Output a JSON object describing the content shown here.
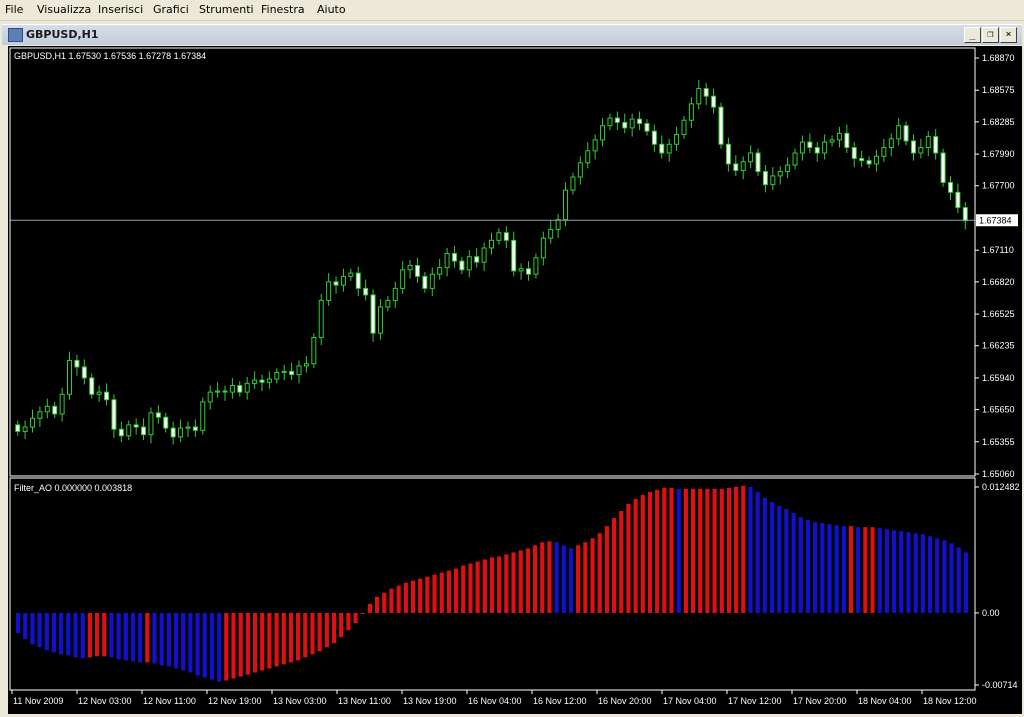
{
  "menu": {
    "items": [
      "File",
      "Visualizza",
      "Inserisci",
      "Grafici",
      "Strumenti",
      "Finestra",
      "Aiuto"
    ]
  },
  "window": {
    "title": "GBPUSD,H1",
    "buttons": {
      "minimize": "_",
      "restore": "❐",
      "close": "×"
    }
  },
  "main_chart": {
    "legend": "GBPUSD,H1  1.67530 1.67536 1.67278 1.67384",
    "current_price_label": "1.67384",
    "current_price_color": "#ffffff",
    "candle_color": "#33cc33",
    "bull_fill": "#000000",
    "bear_fill": "#ffffff"
  },
  "indicator": {
    "legend": "Filter_AO 0.000000 0.003818",
    "up_color": "#dd1111",
    "down_color": "#1111cc"
  },
  "chart_data": [
    {
      "type": "candlestick",
      "title": "GBPUSD,H1",
      "ylim": [
        1.6506,
        1.6887
      ],
      "y_ticks": [
        "1.68870",
        "1.68575",
        "1.68285",
        "1.67990",
        "1.67700",
        "1.67110",
        "1.66820",
        "1.66525",
        "1.66235",
        "1.65940",
        "1.65650",
        "1.65355",
        "1.65060"
      ],
      "x_ticks": [
        "11 Nov 2009",
        "12 Nov 03:00",
        "12 Nov 11:00",
        "12 Nov 19:00",
        "13 Nov 03:00",
        "13 Nov 11:00",
        "13 Nov 19:00",
        "16 Nov 04:00",
        "16 Nov 12:00",
        "16 Nov 20:00",
        "17 Nov 04:00",
        "17 Nov 12:00",
        "17 Nov 20:00",
        "18 Nov 04:00",
        "18 Nov 12:00"
      ],
      "last": {
        "open": 1.6753,
        "high": 1.67536,
        "low": 1.67278,
        "close": 1.67384
      },
      "close": [
        1.6545,
        1.6549,
        1.6557,
        1.6563,
        1.6568,
        1.6561,
        1.6579,
        1.661,
        1.6604,
        1.6594,
        1.6579,
        1.6581,
        1.6574,
        1.6547,
        1.6541,
        1.6551,
        1.6549,
        1.6542,
        1.6562,
        1.6558,
        1.6548,
        1.654,
        1.6548,
        1.6549,
        1.6546,
        1.6572,
        1.6581,
        1.6582,
        1.6581,
        1.6587,
        1.6581,
        1.6589,
        1.6592,
        1.659,
        1.6593,
        1.6599,
        1.66,
        1.6597,
        1.6605,
        1.6607,
        1.6631,
        1.6665,
        1.6682,
        1.6679,
        1.6687,
        1.669,
        1.6676,
        1.667,
        1.6635,
        1.6659,
        1.6665,
        1.6676,
        1.6693,
        1.6697,
        1.6687,
        1.6676,
        1.6689,
        1.6695,
        1.6708,
        1.6701,
        1.6693,
        1.6705,
        1.67,
        1.6713,
        1.672,
        1.6727,
        1.672,
        1.6692,
        1.6694,
        1.6689,
        1.6704,
        1.6722,
        1.673,
        1.6739,
        1.6766,
        1.6778,
        1.6791,
        1.6802,
        1.6812,
        1.6825,
        1.6832,
        1.6828,
        1.6823,
        1.6831,
        1.6827,
        1.682,
        1.6808,
        1.68,
        1.6808,
        1.6817,
        1.683,
        1.6845,
        1.6859,
        1.6852,
        1.6842,
        1.6808,
        1.679,
        1.6784,
        1.6792,
        1.68,
        1.6783,
        1.6771,
        1.6779,
        1.6783,
        1.6789,
        1.68,
        1.681,
        1.6805,
        1.68,
        1.681,
        1.6812,
        1.6818,
        1.6805,
        1.6795,
        1.6793,
        1.679,
        1.6797,
        1.6805,
        1.6813,
        1.6825,
        1.6811,
        1.68,
        1.6805,
        1.6815,
        1.68,
        1.6773,
        1.6764,
        1.675,
        1.6738
      ],
      "note": "approximate hourly closes read from the candlestick chart"
    },
    {
      "type": "bar",
      "title": "Filter_AO",
      "ylim": [
        -0.00714,
        0.012482
      ],
      "y_ticks": [
        "0.012482",
        "0.00",
        "-0.00714"
      ],
      "series": [
        {
          "name": "Filter_AO",
          "values": [
            -0.002,
            -0.0026,
            -0.0031,
            -0.0034,
            -0.0037,
            -0.0039,
            -0.0041,
            -0.0042,
            -0.0044,
            -0.0045,
            -0.0044,
            -0.0043,
            -0.0043,
            -0.0044,
            -0.0046,
            -0.0047,
            -0.0048,
            -0.0049,
            -0.0049,
            -0.005,
            -0.0052,
            -0.0053,
            -0.0055,
            -0.0057,
            -0.0059,
            -0.0062,
            -0.0064,
            -0.0066,
            -0.0068,
            -0.0067,
            -0.0065,
            -0.0063,
            -0.0061,
            -0.0059,
            -0.0057,
            -0.0055,
            -0.0053,
            -0.0051,
            -0.0049,
            -0.0047,
            -0.0044,
            -0.0041,
            -0.0038,
            -0.0034,
            -0.003,
            -0.0024,
            -0.0017,
            -0.001,
            -0.0001,
            0.0009,
            0.0016,
            0.002,
            0.0024,
            0.0027,
            0.003,
            0.0032,
            0.0034,
            0.0036,
            0.0038,
            0.004,
            0.0042,
            0.0044,
            0.0047,
            0.0049,
            0.0051,
            0.0053,
            0.0055,
            0.0056,
            0.0058,
            0.006,
            0.0062,
            0.0064,
            0.0067,
            0.007,
            0.0071,
            0.007,
            0.0067,
            0.0064,
            0.0067,
            0.007,
            0.0074,
            0.0079,
            0.0086,
            0.0094,
            0.0101,
            0.0108,
            0.0113,
            0.0117,
            0.012,
            0.0122,
            0.0124,
            0.0124,
            0.0123,
            0.0123,
            0.0123,
            0.0123,
            0.0123,
            0.0123,
            0.0123,
            0.0124,
            0.0125,
            0.0126,
            0.0125,
            0.012,
            0.0114,
            0.011,
            0.0106,
            0.0103,
            0.0099,
            0.0095,
            0.0092,
            0.009,
            0.0089,
            0.0088,
            0.0087,
            0.0086,
            0.0086,
            0.0085,
            0.0085,
            0.0085,
            0.0084,
            0.0083,
            0.0082,
            0.0081,
            0.008,
            0.0079,
            0.0078,
            0.0076,
            0.0074,
            0.0072,
            0.0069,
            0.0065,
            0.006
          ],
          "colors": "red when rising, blue when falling (Filter_AO)"
        }
      ]
    }
  ]
}
